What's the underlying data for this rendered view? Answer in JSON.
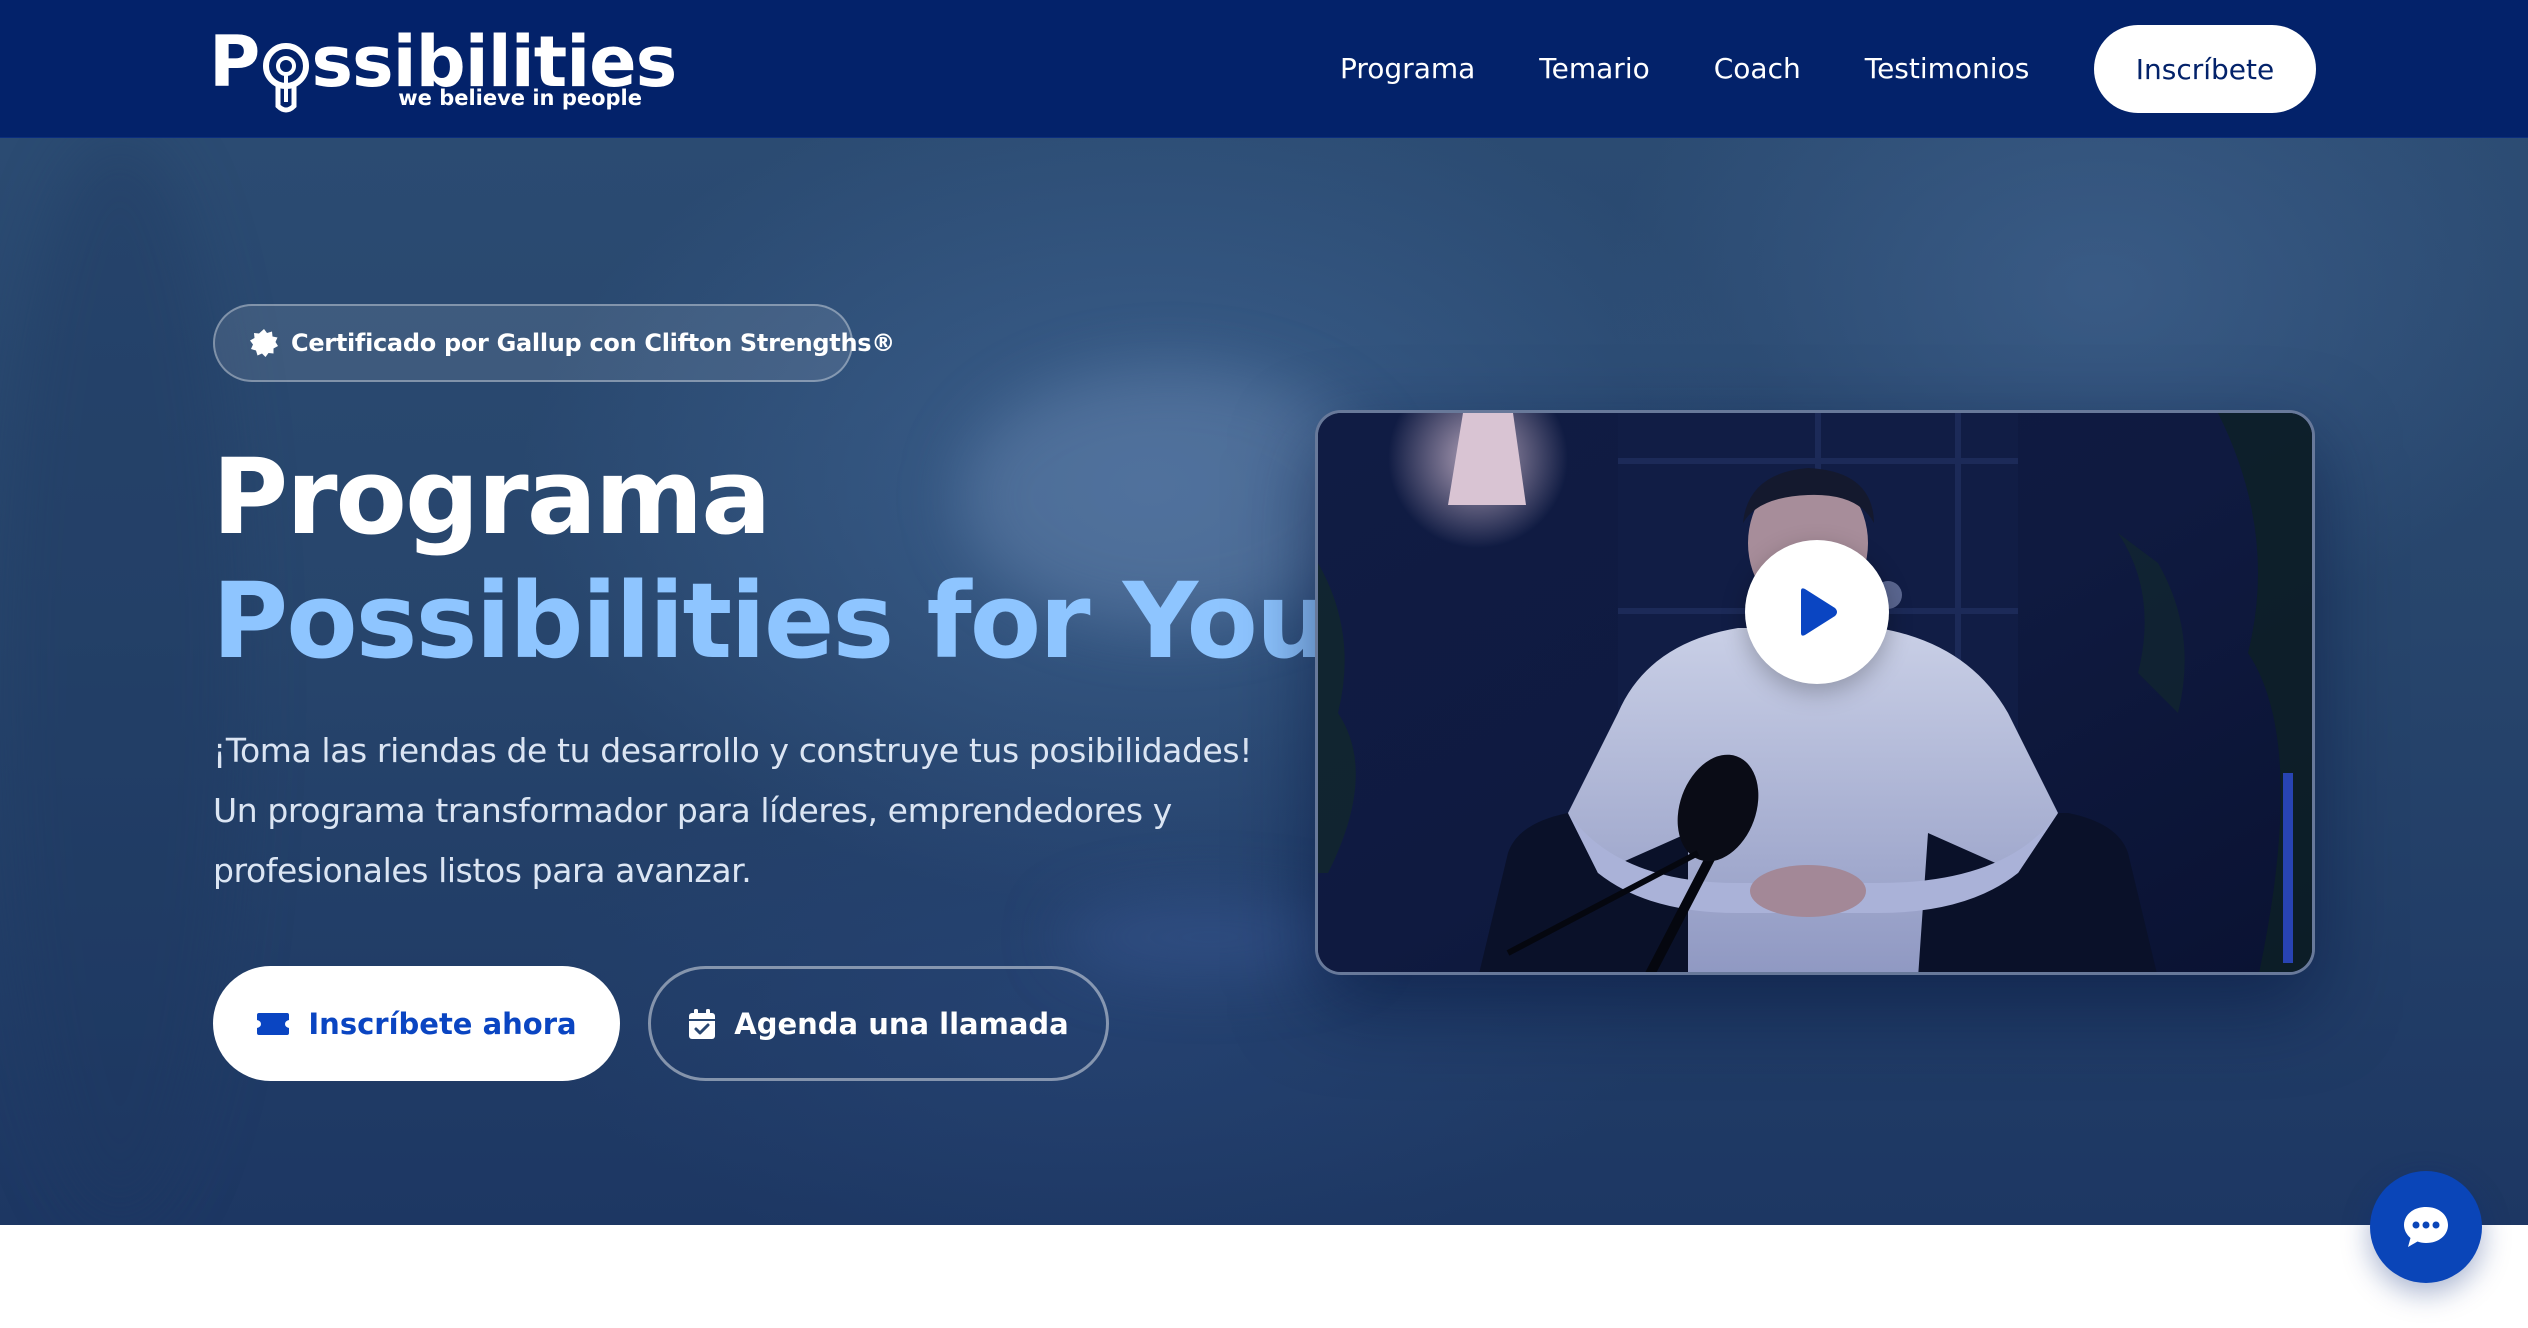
{
  "brand": {
    "name_prefix": "P",
    "name_suffix": "ssibilities",
    "tagline": "we believe in people"
  },
  "nav": {
    "links": [
      "Programa",
      "Temario",
      "Coach",
      "Testimonios"
    ],
    "cta_label": "Inscríbete"
  },
  "hero": {
    "badge_text": "Certificado por Gallup con Clifton Strengths®",
    "title_line1": "Programa",
    "title_line2": "Possibilities for You",
    "description_lines": [
      "¡Toma las riendas de tu desarrollo y construye tus posibilidades!",
      "Un programa transformador para líderes, emprendedores y",
      "profesionales listos para avanzar."
    ],
    "primary_button_label": "Inscríbete ahora",
    "secondary_button_label": "Agenda una llamada"
  },
  "video": {
    "play_icon": "play-icon"
  },
  "chat": {
    "icon": "chat-bubble-icon"
  },
  "colors": {
    "navbar_bg": "#03226a",
    "title_accent": "#8ec5ff",
    "primary_blue": "#0a45c2",
    "chat_fab": "#0a45b8"
  }
}
